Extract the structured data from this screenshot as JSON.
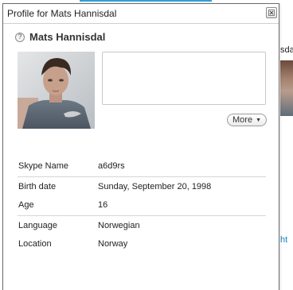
{
  "window": {
    "title": "Profile for Mats Hannisdal",
    "close_icon": "close-icon"
  },
  "profile": {
    "status_icon": "unknown-status-icon",
    "display_name": "Mats Hannisdal",
    "more_label": "More",
    "rows": [
      {
        "label": "Skype Name",
        "value": "a6d9rs"
      },
      {
        "label": "Birth date",
        "value": "Sunday, September 20, 1998"
      },
      {
        "label": "Age",
        "value": "16"
      },
      {
        "label": "Language",
        "value": "Norwegian"
      },
      {
        "label": "Location",
        "value": "Norway"
      }
    ]
  },
  "background": {
    "partial_name": "sdal",
    "partial_link": "ht"
  },
  "colors": {
    "accent": "#2f9fd8",
    "link": "#1a84c6",
    "border": "#6b6b6b"
  }
}
